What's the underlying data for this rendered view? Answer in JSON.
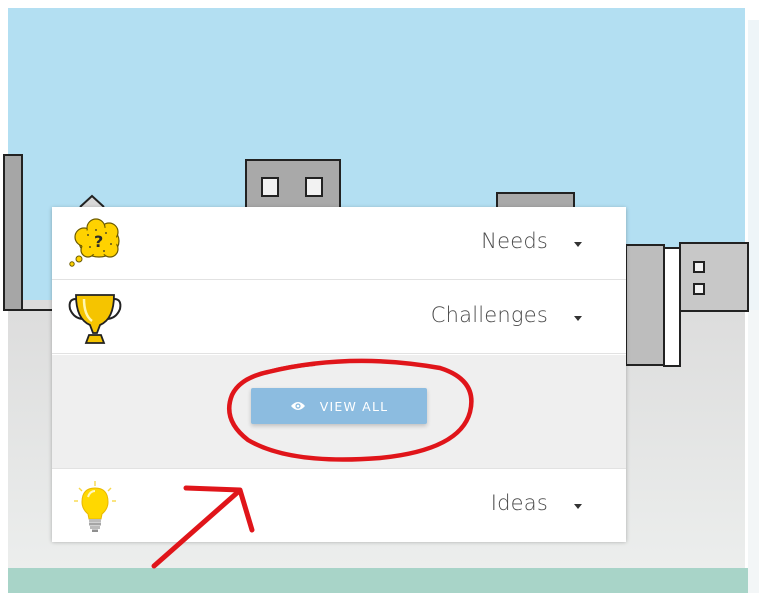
{
  "colors": {
    "sky": "#b3dff2",
    "ground_top": "#dedede",
    "ground_bottom": "#e8ebea",
    "teal_bar": "#a8d4c8",
    "button": "#8cbce0",
    "annotation": "#e0151a"
  },
  "menu": {
    "items": [
      {
        "label": "Needs",
        "icon": "thought-bubble-question-icon"
      },
      {
        "label": "Challenges",
        "icon": "trophy-icon"
      },
      {
        "label": "Ideas",
        "icon": "lightbulb-icon"
      }
    ],
    "view_all": {
      "label": "VIEW ALL",
      "icon": "eye-icon"
    }
  }
}
